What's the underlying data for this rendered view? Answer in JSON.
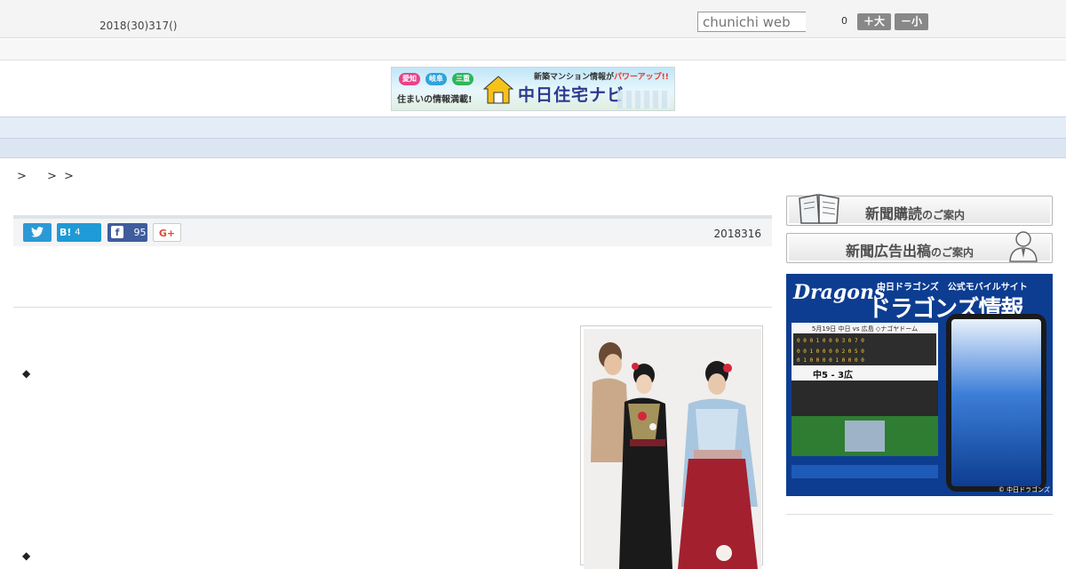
{
  "header": {
    "date_text": "2018(30)317()",
    "search_placeholder": "chunichi web",
    "counter": "0",
    "font_larger": "＋大",
    "font_smaller": "－小"
  },
  "banner": {
    "prefectures": [
      "愛知",
      "岐阜",
      "三重"
    ],
    "tagline": "住まいの情報満載!",
    "brand": "中日住宅ナビ",
    "top_message_prefix": "新築マンション情報が",
    "top_message_accent": "パワーアップ!!"
  },
  "nav": {
    "items": [
      "",
      "",
      "",
      "",
      "",
      "",
      "",
      "",
      ""
    ]
  },
  "breadcrumb": ">　 > >",
  "share": {
    "twitter_icon": "twitter-bird",
    "hatena_label": "B!",
    "hatena_count": "4",
    "facebook_icon": "facebook-f",
    "facebook_count": "95",
    "google_plus_label": "G+"
  },
  "article": {
    "date": "2018316",
    "bullets": [
      "◆",
      "◆"
    ]
  },
  "sidebar": {
    "subscribe_label": "新聞購読",
    "subscribe_suffix": "のご案内",
    "ad_label": "新聞広告出稿",
    "ad_suffix": "のご案内",
    "dragons": {
      "logo": "Dragons",
      "top_text": "中日ドラゴンズ　公式モバイルサイト",
      "title": "ドラゴンズ情報",
      "game_header": "5月19日 中日 vs 広島 ◇ナゴヤドーム",
      "score": "中5 - 3広",
      "footer": "© 中日ドラゴンズ"
    }
  },
  "colors": {
    "nav_bg": "#e4ecf7",
    "twitter": "#2a9ad6",
    "facebook": "#3f5c9d",
    "dragons_blue": "#0d3d91"
  }
}
